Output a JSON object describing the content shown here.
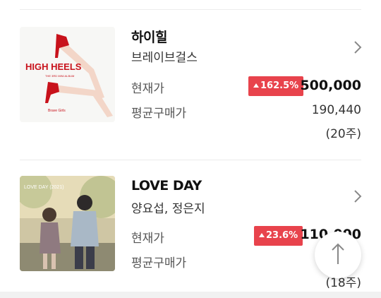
{
  "items": [
    {
      "title": "하이힐",
      "artist": "브레이브걸스",
      "current_label": "현재가",
      "change": "162.5%",
      "price": "500,000",
      "avg_label": "평균구매가",
      "avg_price": "190,440",
      "quantity": "(20주)",
      "cover": {
        "title_text": "HIGH HEELS",
        "subtitle_text": "THE 3RD MINI ALBUM",
        "artist_text": "Brave Girls",
        "icon": "high-heels-artwork"
      }
    },
    {
      "title": "LOVE DAY",
      "artist": "양요섭, 정은지",
      "current_label": "현재가",
      "change": "23.6%",
      "price": "110,000",
      "avg_label": "평균구매가",
      "quantity": "(18주)",
      "cover": {
        "title_text": "LOVE DAY (2021)",
        "icon": "couple-illustration-artwork"
      }
    }
  ],
  "colors": {
    "badge_red": "#e8434c",
    "divider": "#ececec"
  },
  "scroll_top_icon": "arrow-up-icon"
}
